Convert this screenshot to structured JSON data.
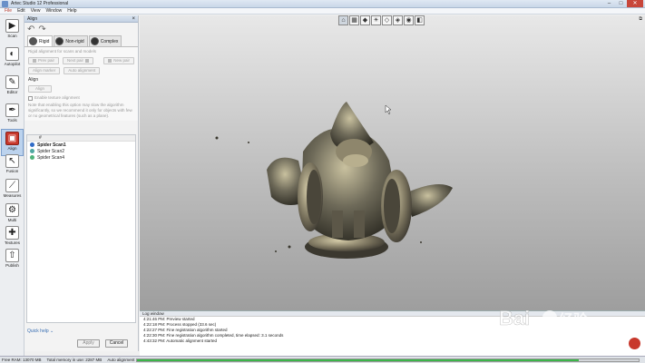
{
  "window": {
    "title": "Artec Studio 12 Professional",
    "minimize_label": "–",
    "maximize_label": "□",
    "close_label": "✕"
  },
  "menu": [
    "File",
    "Edit",
    "View",
    "Window",
    "Help"
  ],
  "toolbar": [
    {
      "label": "Scan",
      "icon": "scan-icon",
      "glyph": "▶"
    },
    {
      "label": "Autopilot",
      "icon": "autopilot-icon",
      "glyph": "◐"
    },
    {
      "label": "Editor",
      "icon": "editor-icon",
      "glyph": "✎"
    },
    {
      "label": "Tools",
      "icon": "tools-icon",
      "glyph": "✒"
    },
    {
      "label": "Align",
      "icon": "align-icon",
      "glyph": "▣"
    },
    {
      "label": "Fusion",
      "icon": "fusion-icon",
      "glyph": "↖"
    },
    {
      "label": "Measures",
      "icon": "measures-icon",
      "glyph": "⟋"
    },
    {
      "label": "Multi",
      "icon": "multi-icon",
      "glyph": "⚙"
    },
    {
      "label": "Textures",
      "icon": "textures-icon",
      "glyph": "✚"
    },
    {
      "label": "Publish",
      "icon": "publish-icon",
      "glyph": "⇧"
    }
  ],
  "panel": {
    "title": "Align",
    "tabs": [
      "Rigid",
      "Non-rigid",
      "Complex"
    ],
    "rigid_desc": "Rigid alignment for scans and models",
    "buttons_row1": [
      "Prev pair",
      "Next pair",
      "New pair"
    ],
    "buttons_row2": [
      "Align marker",
      "Auto alignment"
    ],
    "align_label": "Align",
    "align_button": "Align",
    "texture_checkbox": "Enable texture alignment",
    "texture_note": "Note that enabling this option may slow the algorithm significantly, so we recommend it only for objects with few or no geometrical features (such as a plane)."
  },
  "list": {
    "header": "#",
    "items": [
      {
        "name": "Spider Scan1",
        "color": "#2f6bc7",
        "bold": true
      },
      {
        "name": "Spider Scan2",
        "color": "#4fa7a0",
        "bold": false
      },
      {
        "name": "Spider Scan4",
        "color": "#4fb37a",
        "bold": false
      }
    ]
  },
  "quick_help": "Quick help",
  "footer": {
    "apply": "Apply",
    "cancel": "Cancel"
  },
  "viewport": {
    "tools": [
      "⌂",
      "▦",
      "◆",
      "☀",
      "◇",
      "◈",
      "◉",
      "◧"
    ]
  },
  "log": {
    "title": "Log window",
    "lines": [
      "4:21:46 PM: Preview started",
      "4:22:18 PM: Process stopped (33.6 sec)",
      "4:22:27 PM: Fine registration algorithm started",
      "4:22:30 PM: Fine registration algorithm completed, time elapsed: 3.1 seconds",
      "4:43:32 PM: Automatic alignment started"
    ]
  },
  "status": {
    "free_ram": "Free RAM: 13070 MB",
    "memory_in_app": "Total memory in use: 2287 MB",
    "operation": "Auto alignment",
    "progress": 0.88
  },
  "colors": {
    "accent": "#c8382c",
    "model": "#6e6a59"
  }
}
